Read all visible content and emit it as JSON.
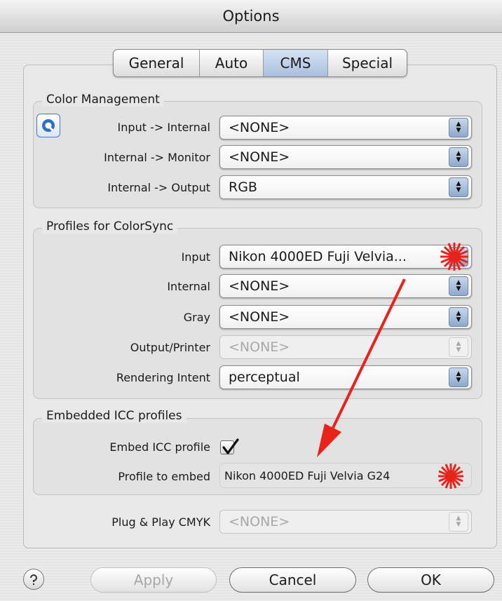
{
  "window": {
    "title": "Options"
  },
  "tabs": [
    {
      "label": "General",
      "active": false
    },
    {
      "label": "Auto",
      "active": false
    },
    {
      "label": "CMS",
      "active": true
    },
    {
      "label": "Special",
      "active": false
    }
  ],
  "color_management": {
    "title": "Color Management",
    "rows": [
      {
        "label": "Input -> Internal",
        "value": "<NONE>"
      },
      {
        "label": "Internal -> Monitor",
        "value": "<NONE>"
      },
      {
        "label": "Internal -> Output",
        "value": "RGB"
      }
    ]
  },
  "profiles": {
    "title": "Profiles for ColorSync",
    "rows": [
      {
        "label": "Input",
        "value": "Nikon 4000ED Fuji Velvia...",
        "enabled": true
      },
      {
        "label": "Internal",
        "value": "<NONE>",
        "enabled": true
      },
      {
        "label": "Gray",
        "value": "<NONE>",
        "enabled": true
      },
      {
        "label": "Output/Printer",
        "value": "<NONE>",
        "enabled": false
      },
      {
        "label": "Rendering Intent",
        "value": "perceptual",
        "enabled": true
      }
    ]
  },
  "embedded": {
    "title": "Embedded ICC profiles",
    "embed_label": "Embed ICC profile",
    "embed_checked": true,
    "profile_label": "Profile to embed",
    "profile_value": "Nikon 4000ED Fuji Velvia G24"
  },
  "cmyk": {
    "label": "Plug & Play CMYK",
    "value": "<NONE>",
    "enabled": false
  },
  "buttons": {
    "apply": "Apply",
    "cancel": "Cancel",
    "ok": "OK"
  },
  "colors": {
    "annotation_red": "#e8231c",
    "accent_blue": "#a9bfdc"
  }
}
